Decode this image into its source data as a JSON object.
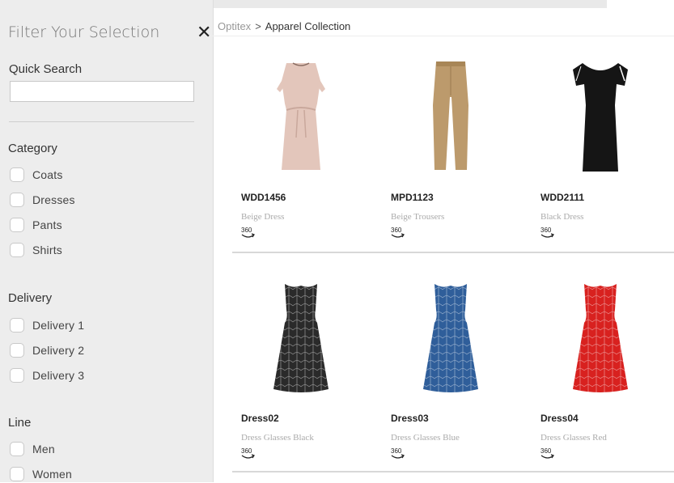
{
  "sidebar": {
    "title": "Filter Your Selection",
    "close_symbol": "✕",
    "quick_search": {
      "label": "Quick Search",
      "value": "",
      "placeholder": ""
    },
    "groups": [
      {
        "title": "Category",
        "options": [
          "Coats",
          "Dresses",
          "Pants",
          "Shirts"
        ]
      },
      {
        "title": "Delivery",
        "options": [
          "Delivery 1",
          "Delivery 2",
          "Delivery 3"
        ]
      },
      {
        "title": "Line",
        "options": [
          "Men",
          "Women"
        ]
      }
    ]
  },
  "breadcrumb": {
    "root": "Optitex",
    "separator": ">",
    "current": "Apparel Collection"
  },
  "products": [
    {
      "code": "WDD1456",
      "name": "Beige Dress",
      "badge": "360",
      "color": "#e3c6bb",
      "shape": "beige-dress"
    },
    {
      "code": "MPD1123",
      "name": "Beige Trousers",
      "badge": "360",
      "color": "#bc9a6c",
      "shape": "trousers"
    },
    {
      "code": "WDD2111",
      "name": "Black Dress",
      "badge": "360",
      "color": "#151515",
      "shape": "black-dress"
    },
    {
      "code": "Dress02",
      "name": "Dress Glasses Black",
      "badge": "360",
      "color": "#2a2a2a",
      "shape": "pattern-dress"
    },
    {
      "code": "Dress03",
      "name": "Dress Glasses Blue",
      "badge": "360",
      "color": "#2f5e9a",
      "shape": "pattern-dress"
    },
    {
      "code": "Dress04",
      "name": "Dress Glasses Red",
      "badge": "360",
      "color": "#d8211f",
      "shape": "pattern-dress"
    }
  ]
}
